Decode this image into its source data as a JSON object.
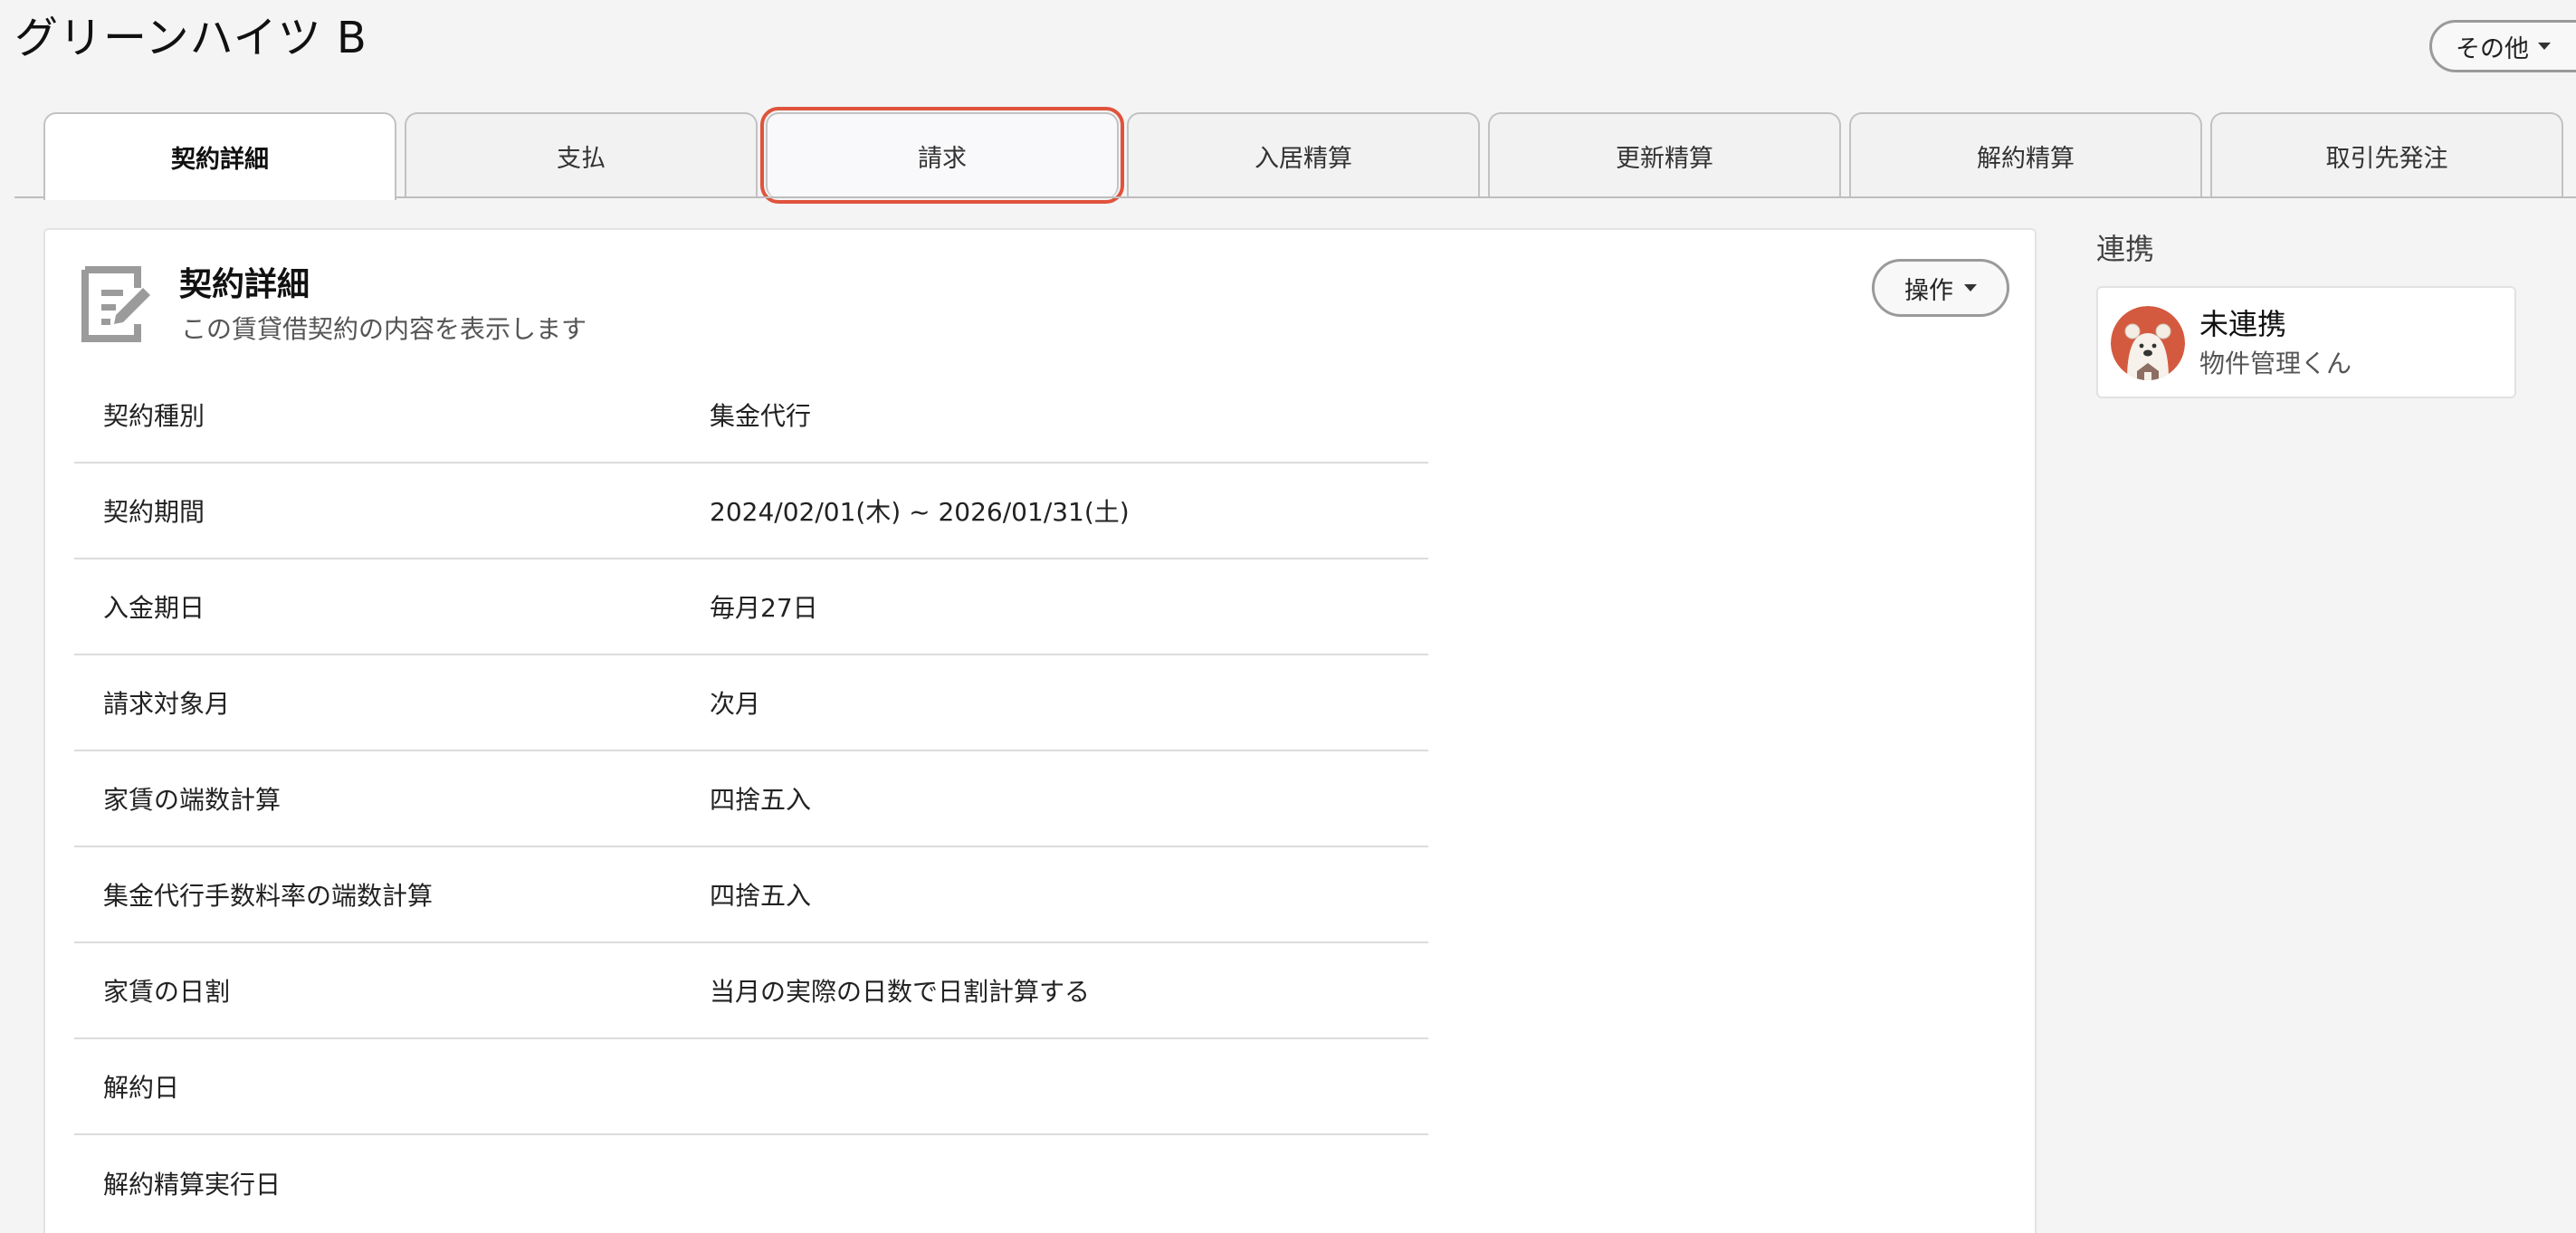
{
  "page": {
    "title": "グリーンハイツ B",
    "other_button_label": "その他"
  },
  "tabs": [
    {
      "label": "契約詳細",
      "active": true
    },
    {
      "label": "支払",
      "active": false
    },
    {
      "label": "請求",
      "active": false,
      "focused": true
    },
    {
      "label": "入居精算",
      "active": false
    },
    {
      "label": "更新精算",
      "active": false
    },
    {
      "label": "解約精算",
      "active": false
    },
    {
      "label": "取引先発注",
      "active": false
    }
  ],
  "panel": {
    "icon": "document-edit-icon",
    "title": "契約詳細",
    "subtitle": "この賃貸借契約の内容を表示します",
    "ops_button_label": "操作",
    "rows": [
      {
        "label": "契約種別",
        "value": "集金代行"
      },
      {
        "label": "契約期間",
        "value": "2024/02/01(木) ~ 2026/01/31(土)"
      },
      {
        "label": "入金期日",
        "value": "毎月27日"
      },
      {
        "label": "請求対象月",
        "value": "次月"
      },
      {
        "label": "家賃の端数計算",
        "value": "四捨五入"
      },
      {
        "label": "集金代行手数料率の端数計算",
        "value": "四捨五入"
      },
      {
        "label": "家賃の日割",
        "value": "当月の実際の日数で日割計算する"
      },
      {
        "label": "解約日",
        "value": ""
      },
      {
        "label": "解約精算実行日",
        "value": ""
      }
    ]
  },
  "sidebar": {
    "heading": "連携",
    "card": {
      "avatar": "bear-mascot-avatar",
      "status": "未連携",
      "service": "物件管理くん"
    }
  },
  "colors": {
    "focus_ring": "#e0533c",
    "avatar_bg": "#d45a3f",
    "background": "#f4f4f4"
  }
}
